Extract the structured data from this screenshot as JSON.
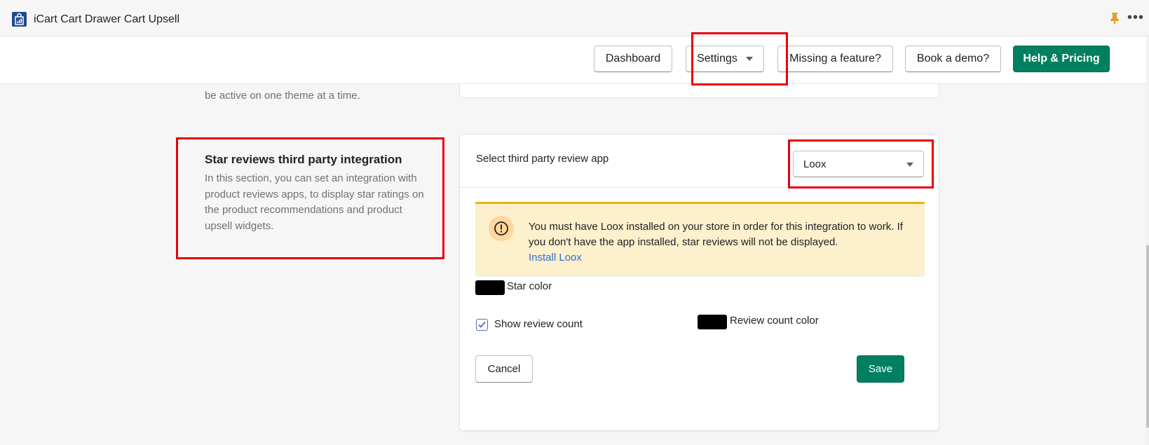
{
  "app_bar": {
    "title": "iCart Cart Drawer Cart Upsell",
    "logo_icon": "shopping-bag-chart-icon",
    "pin_icon": "pin-icon",
    "more_label": "•••"
  },
  "nav": {
    "dashboard": "Dashboard",
    "settings": "Settings",
    "missing_feature": "Missing a feature?",
    "book_demo": "Book a demo?",
    "help_pricing": "Help & Pricing"
  },
  "previous_section": {
    "desc_tail": "be active on one theme at a time."
  },
  "section": {
    "title": "Star reviews third party integration",
    "description": "In this section, you can set an integration with product reviews apps, to display star ratings on the product recommendations and product upsell widgets."
  },
  "card": {
    "select_label": "Select third party review app",
    "select_value": "Loox",
    "banner_text": "You must have Loox installed on your store in order for this integration to work. If you don't have the app installed, star reviews will not be displayed.",
    "banner_link": "Install Loox",
    "star_color_label": "Star color",
    "star_color": "#000000",
    "show_review_count_label": "Show review count",
    "show_review_count_checked": true,
    "review_count_color_label": "Review count color",
    "review_count_color": "#000000",
    "cancel": "Cancel",
    "save": "Save"
  },
  "colors": {
    "primary": "#008060",
    "annotation": "#e8000b",
    "warning_bg": "#fcf0cd",
    "link": "#2c6ecb"
  }
}
